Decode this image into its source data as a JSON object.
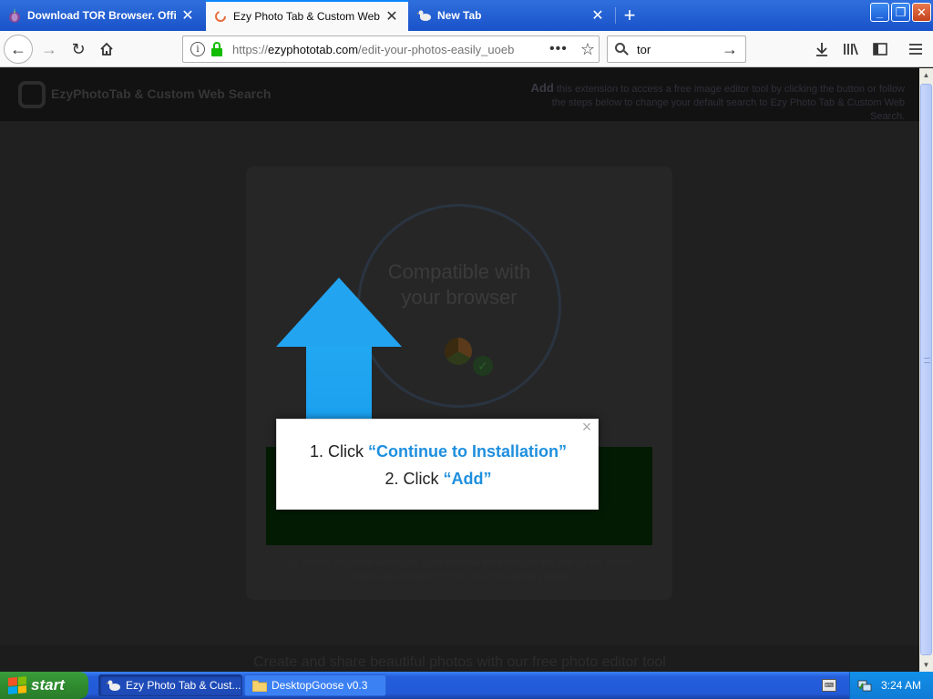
{
  "browser": {
    "tabs": [
      {
        "title": "Download TOR Browser. Official w",
        "icon": "tor-onion-icon",
        "active": false
      },
      {
        "title": "Ezy Photo Tab & Custom Web Sea",
        "icon": "ezyphoto-loading-icon",
        "active": true
      },
      {
        "title": "New Tab",
        "icon": "goose-icon",
        "active": false
      }
    ],
    "new_tab_symbol": "+",
    "window_buttons": {
      "minimize": "_",
      "restore": "❐",
      "close": "✕"
    }
  },
  "navbar": {
    "url_scheme": "https://",
    "url_host": "ezyphototab.com",
    "url_path": "/edit-your-photos-easily_uoeb",
    "info_symbol": "i",
    "more_symbol": "•••",
    "bookmark_symbol": "☆",
    "search_value": "tor",
    "search_go_symbol": "→"
  },
  "page": {
    "site_name": "EzyPhotoTab & Custom Web Search",
    "site_hint_add": "Add",
    "site_hint_text": "this extension to access a free image editor tool by clicking the button or follow the steps below to change your default search to Ezy Photo Tab & Custom Web Search.",
    "compat_line1": "Compatible with",
    "compat_line2": "your browser",
    "small_text": "By clicking the button above you agree to install the extension and change the default search and accept the terms of use and privacy policy.",
    "bottom_text": "Create and share beautiful photos with our free photo editor tool",
    "popup": {
      "line1_prefix": "1. Click ",
      "line1_highlight": "“Continue to Installation”",
      "line2_prefix": "2. Click ",
      "line2_highlight": "“Add”",
      "close_symbol": "×"
    }
  },
  "taskbar": {
    "start_label": "start",
    "tasks": [
      {
        "label": "Ezy Photo Tab & Cust...",
        "active": true
      },
      {
        "label": "DesktopGoose v0.3",
        "active": false
      }
    ],
    "clock": "3:24 AM"
  },
  "colors": {
    "accent_blue": "#1e8fde",
    "arrow_blue": "#22a4f0",
    "xp_taskbar": "#245edb",
    "xp_start_green": "#3a9d3a",
    "secure_lock_green": "#12bc00"
  }
}
